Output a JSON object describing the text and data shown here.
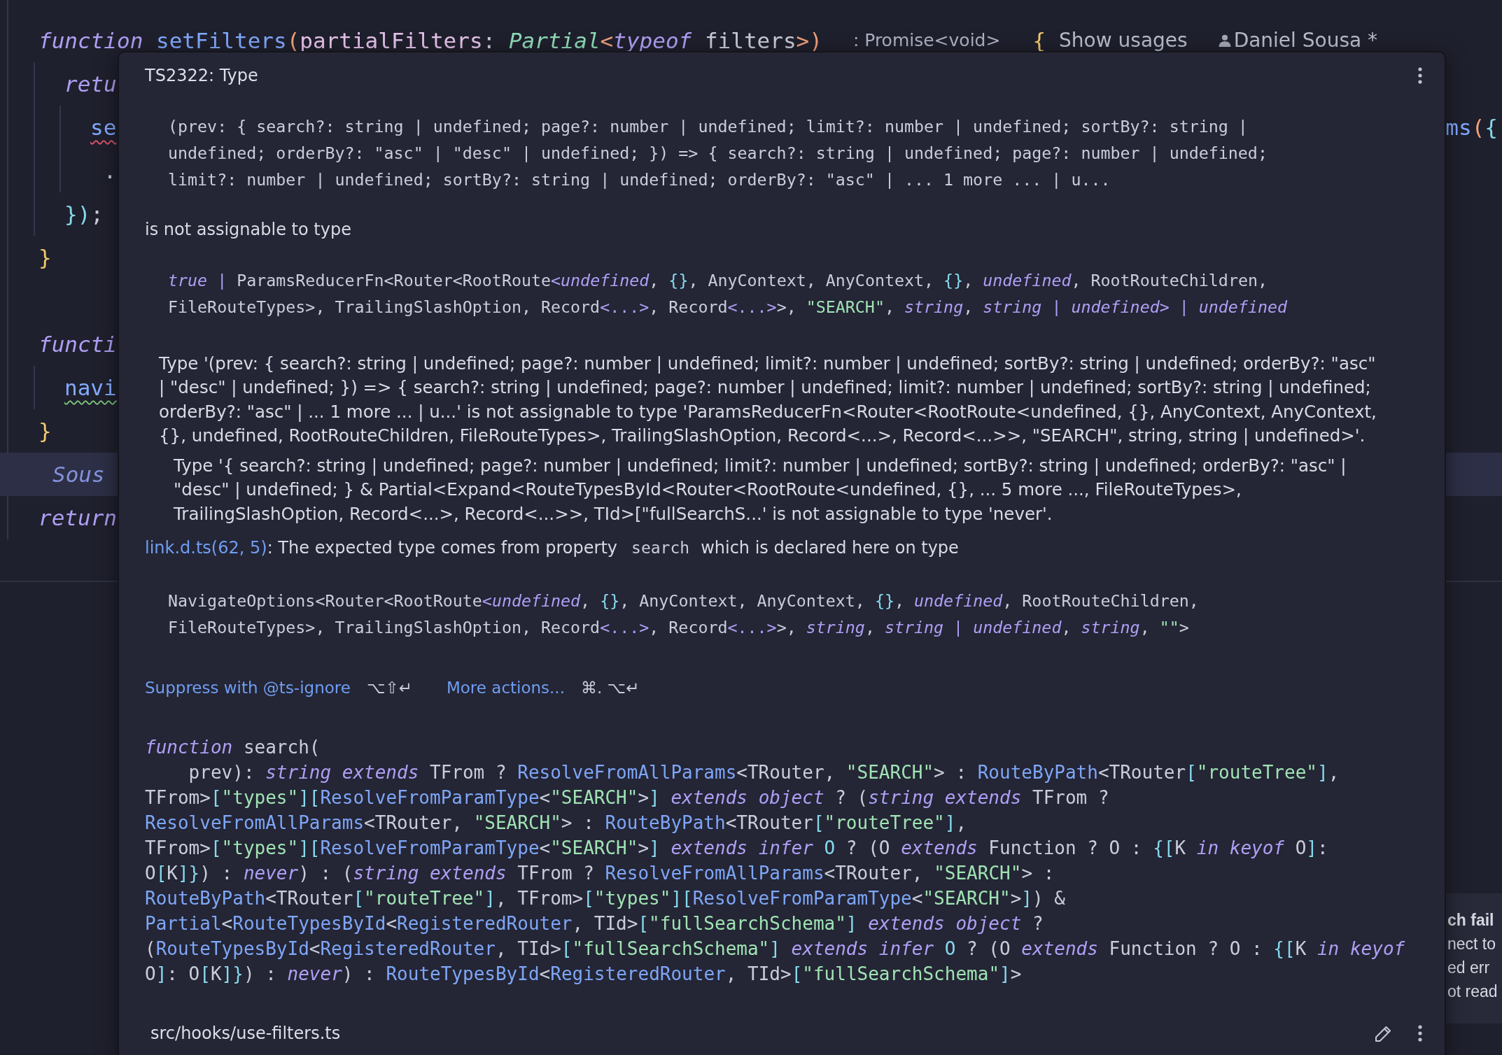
{
  "editor": {
    "blocks": [
      {
        "lines": [
          {
            "tokens": [
              {
                "text": "function ",
                "kind": "keyword"
              },
              {
                "text": "setFilters",
                "kind": "function"
              },
              {
                "text": "(",
                "kind": "paren"
              },
              {
                "text": "partialFilters",
                "kind": "parameter"
              },
              {
                "text": ": ",
                "kind": "plain"
              },
              {
                "text": "Partial",
                "kind": "class"
              },
              {
                "text": "<",
                "kind": "paren"
              },
              {
                "text": "typeof",
                "kind": "keyword"
              },
              {
                "text": " filters",
                "kind": "plain"
              },
              {
                "text": ">)",
                "kind": "paren"
              }
            ],
            "inlay_hint": ": Promise<void>",
            "after_tokens": [
              {
                "text": "{",
                "kind": "brace"
              }
            ],
            "usages": "Show usages",
            "author": "Daniel Sousa *",
            "error": false,
            "warning": false,
            "highlighted": false,
            "children": [
              {
                "tokens": [
                  {
                    "text": "retu",
                    "kind": "keyword"
                  }
                ],
                "error": false,
                "warning": false,
                "highlighted": false,
                "children": [
                  {
                    "tokens": [
                      {
                        "text": "se",
                        "kind": "function"
                      }
                    ],
                    "right_tokens": [
                      {
                        "text": "ms",
                        "kind": "function"
                      },
                      {
                        "text": "(",
                        "kind": "paren"
                      },
                      {
                        "text": "{",
                        "kind": "punct"
                      }
                    ],
                    "error": true,
                    "warning": false,
                    "highlighted": false
                  },
                  {
                    "tokens": [
                      {
                        "text": " .",
                        "kind": "plain"
                      }
                    ],
                    "error": false,
                    "warning": false,
                    "highlighted": false
                  }
                ]
              },
              {
                "tokens": [
                  {
                    "text": "})",
                    "kind": "punct"
                  },
                  {
                    "text": ";",
                    "kind": "plain"
                  }
                ],
                "error": false,
                "warning": false,
                "highlighted": false
              }
            ]
          },
          {
            "tokens": [
              {
                "text": "}",
                "kind": "brace"
              }
            ],
            "error": false,
            "warning": false,
            "highlighted": false
          }
        ]
      },
      {
        "lines": [
          {
            "tokens": [
              {
                "text": "functi",
                "kind": "keyword"
              }
            ],
            "error": false,
            "warning": false,
            "highlighted": false,
            "children": [
              {
                "tokens": [
                  {
                    "text": "navi",
                    "kind": "function"
                  }
                ],
                "error": false,
                "warning": true,
                "highlighted": false
              }
            ]
          },
          {
            "tokens": [
              {
                "text": "}",
                "kind": "brace"
              }
            ],
            "error": false,
            "warning": false,
            "highlighted": false
          },
          {
            "tokens": [
              {
                "text": "Sous",
                "kind": "hint"
              }
            ],
            "error": false,
            "warning": false,
            "highlighted": true
          },
          {
            "tokens": [
              {
                "text": "return",
                "kind": "keyword"
              }
            ],
            "error": false,
            "warning": false,
            "highlighted": false
          }
        ]
      }
    ]
  },
  "notification": {
    "title": "ch fail",
    "lines": [
      "nect to",
      "ed err",
      "ot read"
    ]
  },
  "popup": {
    "title": "TS2322: Type",
    "source_type": [
      {
        "tokens": [
          {
            "text": "(prev: { search?: string | undefined; page?: number | undefined; limit?: number | undefined; sortBy?: string |",
            "kind": "plain"
          }
        ]
      },
      {
        "tokens": [
          {
            "text": "undefined; orderBy?: \"asc\" | \"desc\" | undefined; }) => { search?: string | undefined; page?: number | undefined;",
            "kind": "plain"
          }
        ]
      },
      {
        "tokens": [
          {
            "text": "limit?: number | undefined; sortBy?: string | undefined; orderBy?: \"asc\" | ... 1 more ... | u...",
            "kind": "plain"
          }
        ]
      }
    ],
    "message": "is not assignable to type",
    "target_type": [
      {
        "tokens": [
          {
            "text": "true",
            "kind": "keyword"
          },
          {
            "text": " | ",
            "kind": "operator"
          },
          {
            "text": "ParamsReducerFn<Router<RootRoute",
            "kind": "plain"
          },
          {
            "text": "<",
            "kind": "operator"
          },
          {
            "text": "undefined",
            "kind": "keyword"
          },
          {
            "text": ", ",
            "kind": "plain"
          },
          {
            "text": "{}",
            "kind": "punct"
          },
          {
            "text": ", AnyContext, AnyContext, ",
            "kind": "plain"
          },
          {
            "text": "{}",
            "kind": "punct"
          },
          {
            "text": ", ",
            "kind": "plain"
          },
          {
            "text": "undefined",
            "kind": "keyword"
          },
          {
            "text": ", RootRouteChildren,",
            "kind": "plain"
          }
        ]
      },
      {
        "tokens": [
          {
            "text": "FileRouteTypes>, TrailingSlashOption, Record",
            "kind": "plain"
          },
          {
            "text": "<...>",
            "kind": "operator"
          },
          {
            "text": ", Record",
            "kind": "plain"
          },
          {
            "text": "<...>",
            "kind": "operator"
          },
          {
            "text": ">, ",
            "kind": "plain"
          },
          {
            "text": "\"SEARCH\"",
            "kind": "string"
          },
          {
            "text": ", ",
            "kind": "plain"
          },
          {
            "text": "string",
            "kind": "keyword"
          },
          {
            "text": ", ",
            "kind": "plain"
          },
          {
            "text": "string",
            "kind": "keyword"
          },
          {
            "text": " | ",
            "kind": "operator"
          },
          {
            "text": "undefined",
            "kind": "keyword"
          },
          {
            "text": "> | ",
            "kind": "operator"
          },
          {
            "text": "undefined",
            "kind": "keyword"
          }
        ]
      }
    ],
    "details": [
      {
        "text": "Type '(prev: { search?: string | undefined; page?: number | undefined; limit?: number | undefined; sortBy?: string | undefined; orderBy?: \"asc\" | \"desc\" | undefined; }) => { search?: string | undefined; page?: number | undefined; limit?: number | undefined; sortBy?: string | undefined; orderBy?: \"asc\" | ... 1 more ... | u...' is not assignable to type 'ParamsReducerFn<Router<RootRoute<undefined, {}, AnyContext, AnyContext, {}, undefined, RootRouteChildren, FileRouteTypes>, TrailingSlashOption, Record<...>, Record<...>>, \"SEARCH\", string, string | undefined>'.",
        "children": [
          {
            "text": "Type '{ search?: string | undefined; page?: number | undefined; limit?: number | undefined; sortBy?: string | undefined; orderBy?: \"asc\" | \"desc\" | undefined; } & Partial<Expand<RouteTypesById<Router<RootRoute<undefined, {}, ... 5 more ..., FileRouteTypes>, TrailingSlashOption, Record<...>, Record<...>>, TId>[\"fullSearchS...' is not assignable to type 'never'."
          }
        ]
      }
    ],
    "origin": {
      "link": "link.d.ts(62, 5)",
      "before": ": The expected type comes from property",
      "code": "search",
      "after": "which is declared here on type"
    },
    "declared_type": [
      {
        "tokens": [
          {
            "text": "NavigateOptions<Router<RootRoute",
            "kind": "plain"
          },
          {
            "text": "<",
            "kind": "operator"
          },
          {
            "text": "undefined",
            "kind": "keyword"
          },
          {
            "text": ", ",
            "kind": "plain"
          },
          {
            "text": "{}",
            "kind": "punct"
          },
          {
            "text": ", AnyContext, AnyContext, ",
            "kind": "plain"
          },
          {
            "text": "{}",
            "kind": "punct"
          },
          {
            "text": ", ",
            "kind": "plain"
          },
          {
            "text": "undefined",
            "kind": "keyword"
          },
          {
            "text": ", RootRouteChildren,",
            "kind": "plain"
          }
        ]
      },
      {
        "tokens": [
          {
            "text": "FileRouteTypes>, TrailingSlashOption, Record",
            "kind": "plain"
          },
          {
            "text": "<...>",
            "kind": "operator"
          },
          {
            "text": ", Record",
            "kind": "plain"
          },
          {
            "text": "<...>",
            "kind": "operator"
          },
          {
            "text": ">, ",
            "kind": "plain"
          },
          {
            "text": "string",
            "kind": "keyword"
          },
          {
            "text": ", ",
            "kind": "plain"
          },
          {
            "text": "string",
            "kind": "keyword"
          },
          {
            "text": " | ",
            "kind": "operator"
          },
          {
            "text": "undefined",
            "kind": "keyword"
          },
          {
            "text": ", ",
            "kind": "plain"
          },
          {
            "text": "string",
            "kind": "keyword"
          },
          {
            "text": ", ",
            "kind": "plain"
          },
          {
            "text": "\"\"",
            "kind": "string"
          },
          {
            "text": ">",
            "kind": "plain"
          }
        ]
      }
    ],
    "actions": [
      {
        "label": "Suppress with @ts-ignore",
        "shortcut": "⌥⇧↵"
      },
      {
        "label": "More actions...",
        "shortcut": "⌘. ⌥↵"
      }
    ],
    "signature": [
      {
        "tokens": [
          {
            "text": "function",
            "kind": "keyword"
          },
          {
            "text": " search(",
            "kind": "plain"
          }
        ]
      },
      {
        "tokens": [
          {
            "text": "    prev): ",
            "kind": "plain"
          },
          {
            "text": "string extends",
            "kind": "keyword"
          },
          {
            "text": " TFrom ? ",
            "kind": "plain"
          },
          {
            "text": "ResolveFromAllParams",
            "kind": "type"
          },
          {
            "text": "<TRouter, ",
            "kind": "plain"
          },
          {
            "text": "\"SEARCH\"",
            "kind": "string"
          },
          {
            "text": "> : ",
            "kind": "plain"
          },
          {
            "text": "RouteByPath",
            "kind": "type"
          },
          {
            "text": "<TRouter",
            "kind": "plain"
          },
          {
            "text": "[",
            "kind": "punct"
          },
          {
            "text": "\"routeTree\"",
            "kind": "string"
          },
          {
            "text": "]",
            "kind": "punct"
          },
          {
            "text": ",",
            "kind": "plain"
          }
        ]
      },
      {
        "tokens": [
          {
            "text": "TFrom>",
            "kind": "plain"
          },
          {
            "text": "[",
            "kind": "punct"
          },
          {
            "text": "\"types\"",
            "kind": "string"
          },
          {
            "text": "][",
            "kind": "punct"
          },
          {
            "text": "ResolveFromParamType",
            "kind": "type"
          },
          {
            "text": "<",
            "kind": "plain"
          },
          {
            "text": "\"SEARCH\"",
            "kind": "string"
          },
          {
            "text": ">",
            "kind": "plain"
          },
          {
            "text": "]",
            "kind": "punct"
          },
          {
            "text": " extends object",
            "kind": "keyword"
          },
          {
            "text": " ? (",
            "kind": "plain"
          },
          {
            "text": "string extends",
            "kind": "keyword"
          },
          {
            "text": " TFrom ?",
            "kind": "plain"
          }
        ]
      },
      {
        "tokens": [
          {
            "text": "ResolveFromAllParams",
            "kind": "type"
          },
          {
            "text": "<TRouter, ",
            "kind": "plain"
          },
          {
            "text": "\"SEARCH\"",
            "kind": "string"
          },
          {
            "text": "> : ",
            "kind": "plain"
          },
          {
            "text": "RouteByPath",
            "kind": "type"
          },
          {
            "text": "<TRouter",
            "kind": "plain"
          },
          {
            "text": "[",
            "kind": "punct"
          },
          {
            "text": "\"routeTree\"",
            "kind": "string"
          },
          {
            "text": "]",
            "kind": "punct"
          },
          {
            "text": ",",
            "kind": "plain"
          }
        ]
      },
      {
        "tokens": [
          {
            "text": "TFrom>",
            "kind": "plain"
          },
          {
            "text": "[",
            "kind": "punct"
          },
          {
            "text": "\"types\"",
            "kind": "string"
          },
          {
            "text": "][",
            "kind": "punct"
          },
          {
            "text": "ResolveFromParamType",
            "kind": "type"
          },
          {
            "text": "<",
            "kind": "plain"
          },
          {
            "text": "\"SEARCH\"",
            "kind": "string"
          },
          {
            "text": ">",
            "kind": "plain"
          },
          {
            "text": "]",
            "kind": "punct"
          },
          {
            "text": " extends infer",
            "kind": "keyword"
          },
          {
            "text": " O",
            "kind": "typeparam"
          },
          {
            "text": " ? (O ",
            "kind": "plain"
          },
          {
            "text": "extends",
            "kind": "keyword"
          },
          {
            "text": " Function ? O : ",
            "kind": "plain"
          },
          {
            "text": "{[",
            "kind": "punct"
          },
          {
            "text": "K ",
            "kind": "plain"
          },
          {
            "text": "in keyof",
            "kind": "keyword"
          },
          {
            "text": " O",
            "kind": "plain"
          },
          {
            "text": "]",
            "kind": "punct"
          },
          {
            "text": ":",
            "kind": "plain"
          }
        ]
      },
      {
        "tokens": [
          {
            "text": "O",
            "kind": "plain"
          },
          {
            "text": "[",
            "kind": "punct"
          },
          {
            "text": "K",
            "kind": "plain"
          },
          {
            "text": "]}",
            "kind": "punct"
          },
          {
            "text": ") : ",
            "kind": "plain"
          },
          {
            "text": "never",
            "kind": "keyword"
          },
          {
            "text": ") : (",
            "kind": "plain"
          },
          {
            "text": "string extends",
            "kind": "keyword"
          },
          {
            "text": " TFrom ? ",
            "kind": "plain"
          },
          {
            "text": "ResolveFromAllParams",
            "kind": "type"
          },
          {
            "text": "<TRouter, ",
            "kind": "plain"
          },
          {
            "text": "\"SEARCH\"",
            "kind": "string"
          },
          {
            "text": "> :",
            "kind": "plain"
          }
        ]
      },
      {
        "tokens": [
          {
            "text": "RouteByPath",
            "kind": "type"
          },
          {
            "text": "<TRouter",
            "kind": "plain"
          },
          {
            "text": "[",
            "kind": "punct"
          },
          {
            "text": "\"routeTree\"",
            "kind": "string"
          },
          {
            "text": "]",
            "kind": "punct"
          },
          {
            "text": ", TFrom>",
            "kind": "plain"
          },
          {
            "text": "[",
            "kind": "punct"
          },
          {
            "text": "\"types\"",
            "kind": "string"
          },
          {
            "text": "][",
            "kind": "punct"
          },
          {
            "text": "ResolveFromParamType",
            "kind": "type"
          },
          {
            "text": "<",
            "kind": "plain"
          },
          {
            "text": "\"SEARCH\"",
            "kind": "string"
          },
          {
            "text": ">",
            "kind": "plain"
          },
          {
            "text": "]",
            "kind": "punct"
          },
          {
            "text": ") &",
            "kind": "plain"
          }
        ]
      },
      {
        "tokens": [
          {
            "text": "Partial",
            "kind": "type"
          },
          {
            "text": "<",
            "kind": "plain"
          },
          {
            "text": "RouteTypesById",
            "kind": "type"
          },
          {
            "text": "<",
            "kind": "plain"
          },
          {
            "text": "RegisteredRouter",
            "kind": "type"
          },
          {
            "text": ", TId>",
            "kind": "plain"
          },
          {
            "text": "[",
            "kind": "punct"
          },
          {
            "text": "\"fullSearchSchema\"",
            "kind": "string"
          },
          {
            "text": "]",
            "kind": "punct"
          },
          {
            "text": " extends object",
            "kind": "keyword"
          },
          {
            "text": " ?",
            "kind": "plain"
          }
        ]
      },
      {
        "tokens": [
          {
            "text": "(",
            "kind": "plain"
          },
          {
            "text": "RouteTypesById",
            "kind": "type"
          },
          {
            "text": "<",
            "kind": "plain"
          },
          {
            "text": "RegisteredRouter",
            "kind": "type"
          },
          {
            "text": ", TId>",
            "kind": "plain"
          },
          {
            "text": "[",
            "kind": "punct"
          },
          {
            "text": "\"fullSearchSchema\"",
            "kind": "string"
          },
          {
            "text": "]",
            "kind": "punct"
          },
          {
            "text": " extends infer",
            "kind": "keyword"
          },
          {
            "text": " O",
            "kind": "typeparam"
          },
          {
            "text": " ? (O ",
            "kind": "plain"
          },
          {
            "text": "extends",
            "kind": "keyword"
          },
          {
            "text": " Function ? O : ",
            "kind": "plain"
          },
          {
            "text": "{[",
            "kind": "punct"
          },
          {
            "text": "K ",
            "kind": "plain"
          },
          {
            "text": "in keyof",
            "kind": "keyword"
          }
        ]
      },
      {
        "tokens": [
          {
            "text": "O",
            "kind": "plain"
          },
          {
            "text": "]",
            "kind": "punct"
          },
          {
            "text": ": O",
            "kind": "plain"
          },
          {
            "text": "[",
            "kind": "punct"
          },
          {
            "text": "K",
            "kind": "plain"
          },
          {
            "text": "]}",
            "kind": "punct"
          },
          {
            "text": ") : ",
            "kind": "plain"
          },
          {
            "text": "never",
            "kind": "keyword"
          },
          {
            "text": ") : ",
            "kind": "plain"
          },
          {
            "text": "RouteTypesById",
            "kind": "type"
          },
          {
            "text": "<",
            "kind": "plain"
          },
          {
            "text": "RegisteredRouter",
            "kind": "type"
          },
          {
            "text": ", TId>",
            "kind": "plain"
          },
          {
            "text": "[",
            "kind": "punct"
          },
          {
            "text": "\"fullSearchSchema\"",
            "kind": "string"
          },
          {
            "text": "]",
            "kind": "punct"
          },
          {
            "text": ">",
            "kind": "plain"
          }
        ]
      }
    ],
    "file_path": "src/hooks/use-filters.ts"
  }
}
